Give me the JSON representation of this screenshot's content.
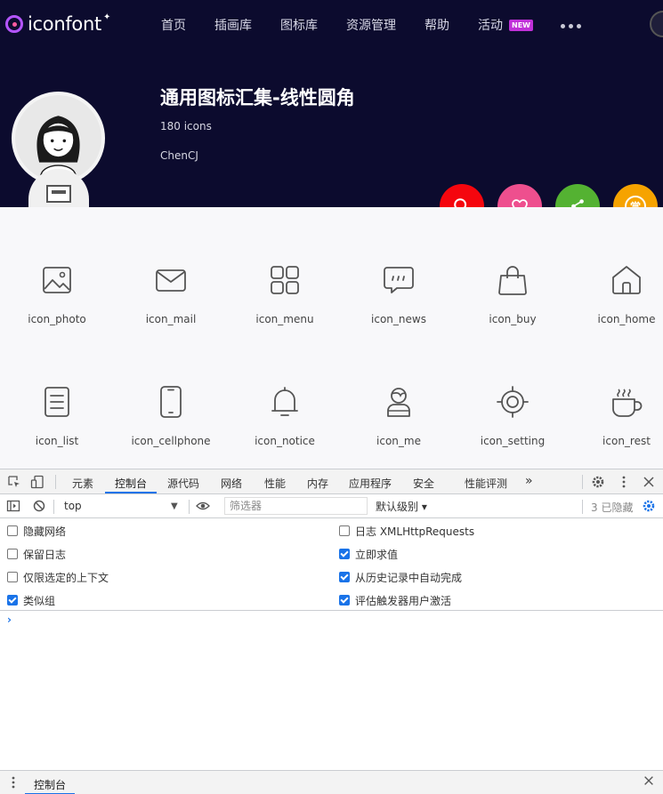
{
  "site": {
    "logo_text": "iconfont",
    "logo_star": "✦",
    "nav": [
      {
        "label": "首页"
      },
      {
        "label": "插画库"
      },
      {
        "label": "图标库"
      },
      {
        "label": "资源管理"
      },
      {
        "label": "帮助"
      },
      {
        "label": "活动"
      }
    ],
    "nav_badge": "NEW"
  },
  "collection": {
    "title": "通用图标汇集-线性圆角",
    "count": "180 icons",
    "author": "ChenCJ"
  },
  "actions": {
    "reward_glyph": "赏"
  },
  "colors": {
    "header_bg": "#0c0b2e",
    "search": "#f5060e",
    "like": "#ee4f8e",
    "share": "#54b232",
    "reward": "#f6a300",
    "devtools_accent": "#1a73e8"
  },
  "icons": [
    {
      "label": "icon_photo"
    },
    {
      "label": "icon_mail"
    },
    {
      "label": "icon_menu"
    },
    {
      "label": "icon_news"
    },
    {
      "label": "icon_buy"
    },
    {
      "label": "icon_home"
    },
    {
      "label": "icon_list"
    },
    {
      "label": "icon_cellphone"
    },
    {
      "label": "icon_notice"
    },
    {
      "label": "icon_me"
    },
    {
      "label": "icon_setting"
    },
    {
      "label": "icon_rest"
    }
  ],
  "devtools": {
    "tabs": [
      "元素",
      "控制台",
      "源代码",
      "网络",
      "性能",
      "内存",
      "应用程序",
      "安全",
      "性能评测"
    ],
    "more_tabs": "»",
    "context": "top",
    "filter_placeholder": "筛选器",
    "level": "默认级别 ▾",
    "hidden": "3 已隐藏",
    "settings_left": [
      {
        "label": "隐藏网络",
        "checked": false
      },
      {
        "label": "保留日志",
        "checked": false
      },
      {
        "label": "仅限选定的上下文",
        "checked": false
      },
      {
        "label": "类似组",
        "checked": true
      }
    ],
    "settings_right": [
      {
        "label": "日志 XMLHttpRequests",
        "checked": false
      },
      {
        "label": "立即求值",
        "checked": true
      },
      {
        "label": "从历史记录中自动完成",
        "checked": true
      },
      {
        "label": "评估触发器用户激活",
        "checked": true
      }
    ],
    "prompt": "›",
    "drawer_tab": "控制台"
  }
}
